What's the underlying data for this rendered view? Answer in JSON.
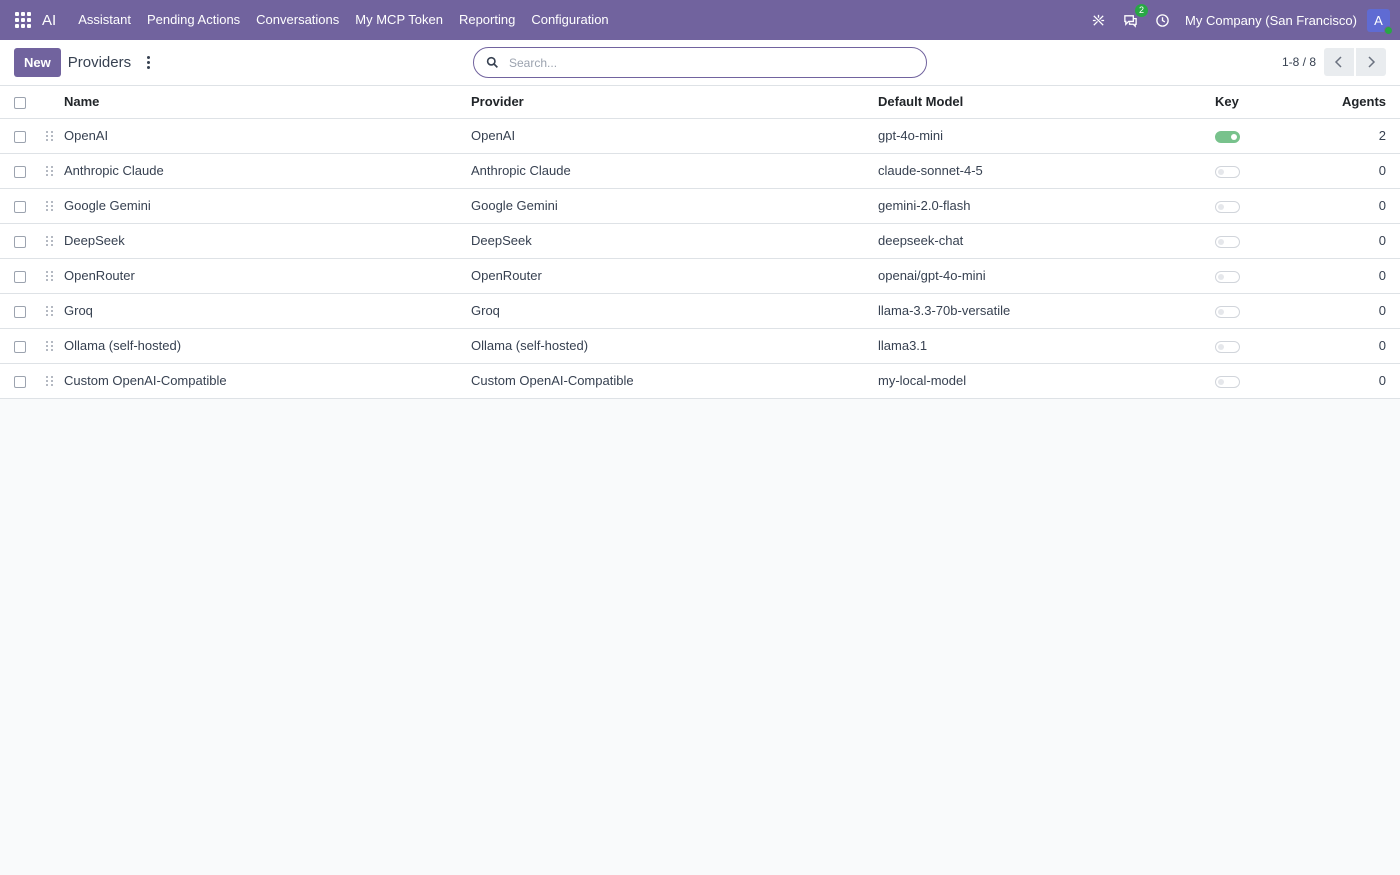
{
  "navbar": {
    "brand": "AI",
    "menu": [
      "Assistant",
      "Pending Actions",
      "Conversations",
      "My MCP Token",
      "Reporting",
      "Configuration"
    ],
    "messages_count": "2",
    "company": "My Company (San Francisco)",
    "avatar_letter": "A",
    "icons": [
      "apps-icon",
      "debug-icon",
      "chat-icon",
      "clock-icon"
    ]
  },
  "control": {
    "new_label": "New",
    "title": "Providers",
    "search_placeholder": "Search...",
    "pager": "1-8 / 8"
  },
  "table": {
    "columns": [
      "Name",
      "Provider",
      "Default Model",
      "Key",
      "Agents"
    ],
    "rows": [
      {
        "name": "OpenAI",
        "provider": "OpenAI",
        "model": "gpt-4o-mini",
        "key": true,
        "agents": "2"
      },
      {
        "name": "Anthropic Claude",
        "provider": "Anthropic Claude",
        "model": "claude-sonnet-4-5",
        "key": false,
        "agents": "0"
      },
      {
        "name": "Google Gemini",
        "provider": "Google Gemini",
        "model": "gemini-2.0-flash",
        "key": false,
        "agents": "0"
      },
      {
        "name": "DeepSeek",
        "provider": "DeepSeek",
        "model": "deepseek-chat",
        "key": false,
        "agents": "0"
      },
      {
        "name": "OpenRouter",
        "provider": "OpenRouter",
        "model": "openai/gpt-4o-mini",
        "key": false,
        "agents": "0"
      },
      {
        "name": "Groq",
        "provider": "Groq",
        "model": "llama-3.3-70b-versatile",
        "key": false,
        "agents": "0"
      },
      {
        "name": "Ollama (self-hosted)",
        "provider": "Ollama (self-hosted)",
        "model": "llama3.1",
        "key": false,
        "agents": "0"
      },
      {
        "name": "Custom OpenAI-Compatible",
        "provider": "Custom OpenAI-Compatible",
        "model": "my-local-model",
        "key": false,
        "agents": "0"
      }
    ]
  },
  "colors": {
    "brand": "#71639e",
    "toggle_on": "#78c28c",
    "badge": "#28a745"
  }
}
